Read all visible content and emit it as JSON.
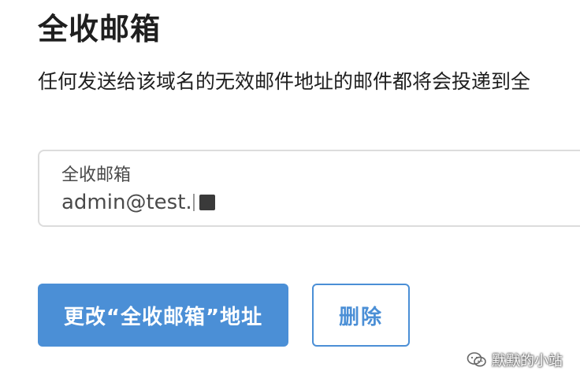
{
  "header": {
    "title": "全收邮箱"
  },
  "description": "任何发送给该域名的无效邮件地址的邮件都将会投递到全",
  "field": {
    "label": "全收邮箱",
    "value": "admin@test."
  },
  "buttons": {
    "change_label": "更改“全收邮箱”地址",
    "delete_label": "删除"
  },
  "watermark": {
    "text": "默默的小站",
    "icon": "wechat-icon"
  },
  "colors": {
    "primary": "#4b8fd6",
    "border": "#dcdcdc",
    "text": "#1f1f1f"
  }
}
